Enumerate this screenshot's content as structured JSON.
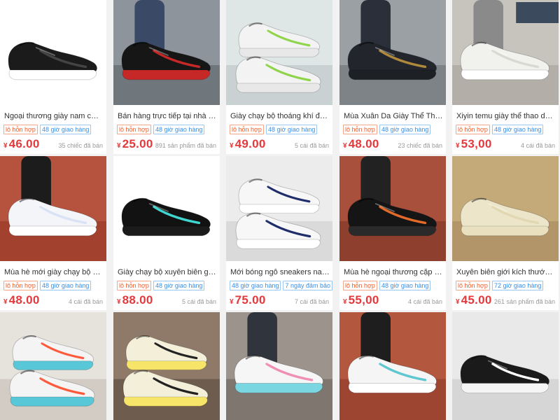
{
  "colors": {
    "price": "#e4393c",
    "tag_red": "#f15a24",
    "tag_blue": "#3a8ee6"
  },
  "products": [
    {
      "image": "black-sneaker-white-sole-icon",
      "title": "Ngoại thương giày nam cỡ lớn ...",
      "tags": [
        {
          "text": "lô hỗn hợp",
          "style": "red"
        },
        {
          "text": "48 giờ giao hàng",
          "style": "blue"
        }
      ],
      "currency": "¥",
      "price": "46.00",
      "sold": "35 chiếc đã bán"
    },
    {
      "image": "black-red-sneaker-on-foot-icon",
      "title": "Bán hàng trực tiếp tại nhà máy ...",
      "tags": [
        {
          "text": "lô hỗn hợp",
          "style": "red"
        },
        {
          "text": "48 giờ giao hàng",
          "style": "blue"
        }
      ],
      "currency": "¥",
      "price": "25.00",
      "sold": "891 sản phẩm đã bán"
    },
    {
      "image": "white-green-running-shoe-pair-icon",
      "title": "Giày chạy bộ thoáng khí đan hỗ...",
      "tags": [
        {
          "text": "lô hỗn hợp",
          "style": "red"
        },
        {
          "text": "48 giờ giao hàng",
          "style": "blue"
        }
      ],
      "currency": "¥",
      "price": "49.00",
      "sold": "5 cái đã bán"
    },
    {
      "image": "black-leather-sneaker-on-foot-icon",
      "title": "Mùa Xuân Da Giày Thể Thao Na...",
      "tags": [
        {
          "text": "lô hỗn hợp",
          "style": "red"
        },
        {
          "text": "48 giờ giao hàng",
          "style": "blue"
        }
      ],
      "currency": "¥",
      "price": "48.00",
      "sold": "23 chiếc đã bán"
    },
    {
      "image": "white-knit-sneaker-on-foot-icon",
      "title": "Xiyin temu giày thể thao dệt ba...",
      "tags": [
        {
          "text": "lô hỗn hợp",
          "style": "red"
        },
        {
          "text": "48 giờ giao hàng",
          "style": "blue"
        }
      ],
      "currency": "¥",
      "price": "53,00",
      "sold": "4 cái đã bán"
    },
    {
      "image": "white-running-shoe-track-icon",
      "title": "Mùa hè mới giày chạy bộ nam ...",
      "tags": [
        {
          "text": "lô hỗn hợp",
          "style": "red"
        },
        {
          "text": "48 giờ giao hàng",
          "style": "blue"
        }
      ],
      "currency": "¥",
      "price": "48.00",
      "sold": "4 cái đã bán"
    },
    {
      "image": "black-cyan-air-sneaker-icon",
      "title": "Giày chạy bộ xuyên biên giới siz...",
      "tags": [
        {
          "text": "lô hỗn hợp",
          "style": "red"
        },
        {
          "text": "48 giờ giao hàng",
          "style": "blue"
        }
      ],
      "currency": "¥",
      "price": "88.00",
      "sold": "5 cái đã bán"
    },
    {
      "image": "white-navy-sneaker-pair-icon",
      "title": "Mới bóng ngô sneakers nam giả...",
      "tags": [
        {
          "text": "48 giờ giao hàng",
          "style": "blue"
        },
        {
          "text": "7 ngày đảm bảo",
          "style": "blue"
        }
      ],
      "currency": "¥",
      "price": "75.00",
      "sold": "7 cái đã bán"
    },
    {
      "image": "black-blade-sneaker-on-foot-icon",
      "title": "Mùa hè ngoại thương cặp đôi gi...",
      "tags": [
        {
          "text": "lô hỗn hợp",
          "style": "red"
        },
        {
          "text": "48 giờ giao hàng",
          "style": "blue"
        }
      ],
      "currency": "¥",
      "price": "55,00",
      "sold": "4 cái đã bán"
    },
    {
      "image": "beige-foam-sock-shoe-icon",
      "title": "Xuyên biên giới kích thước lớn c...",
      "tags": [
        {
          "text": "lô hỗn hợp",
          "style": "red"
        },
        {
          "text": "72 giờ giao hàng",
          "style": "blue"
        }
      ],
      "currency": "¥",
      "price": "45.00",
      "sold": "261 sản phẩm đã bán"
    },
    {
      "image": "colorful-running-shoe-pair-icon",
      "title": "",
      "tags": [],
      "currency": "",
      "price": "",
      "sold": ""
    },
    {
      "image": "retro-sneaker-pair-icon",
      "title": "",
      "tags": [],
      "currency": "",
      "price": "",
      "sold": ""
    },
    {
      "image": "white-gradient-sneaker-stairs-icon",
      "title": "",
      "tags": [],
      "currency": "",
      "price": "",
      "sold": ""
    },
    {
      "image": "white-sneaker-track-on-foot-icon",
      "title": "",
      "tags": [],
      "currency": "",
      "price": "",
      "sold": ""
    },
    {
      "image": "black-white-sneaker-icon",
      "title": "",
      "tags": [],
      "currency": "",
      "price": "",
      "sold": ""
    }
  ]
}
